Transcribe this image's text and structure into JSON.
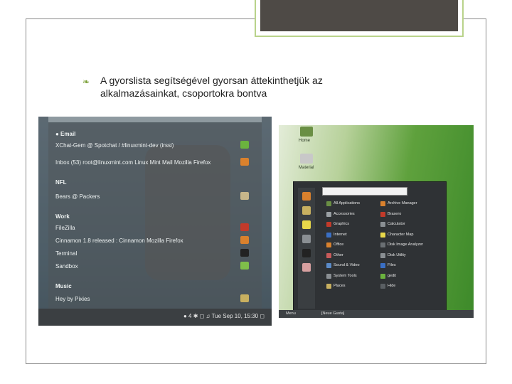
{
  "slide": {
    "bullet_text": "A gyorslista segítségével gyorsan áttekinthetjük az alkalmazásainkat, csoportokra bontva",
    "bullet_icon": "leaf-bullet-icon",
    "accent_color": "#7ea23c"
  },
  "left_screenshot": {
    "menu": [
      {
        "text": "● Email",
        "head": true
      },
      {
        "text": "XChat-Gem @ Spotchat / #linuxmint-dev (irssi)",
        "head": false,
        "icon_color": "#6bb33e"
      },
      {
        "text": "Inbox (53)   root@linuxmint.com   Linux Mint Mail   Mozilla Firefox",
        "head": false,
        "icon_color": "#d9812d"
      },
      {
        "text": "NFL",
        "head": true
      },
      {
        "text": "Bears @ Packers",
        "head": false,
        "icon_color": "#c7b68a"
      },
      {
        "text": "Work",
        "head": true
      },
      {
        "text": "FileZilla",
        "head": false,
        "icon_color": "#c23a2a"
      },
      {
        "text": "Cinnamon 1.8 released : Cinnamon   Mozilla Firefox",
        "head": false,
        "icon_color": "#d9812d"
      },
      {
        "text": "Terminal",
        "head": false,
        "icon_color": "#222222"
      },
      {
        "text": "Sandbox",
        "head": false,
        "icon_color": "#7fbf4a"
      },
      {
        "text": "Music",
        "head": true
      },
      {
        "text": "Hey by Pixies",
        "head": false,
        "icon_color": "#c8b060"
      }
    ],
    "tray_text": "● 4   ✱   ◻ ♫   Tue Sep 10, 15:30 ◻"
  },
  "right_screenshot": {
    "desktop_icons": [
      {
        "label": "Home",
        "color": "#6a8f44"
      },
      {
        "label": "Material",
        "color": "#c8c8c8"
      }
    ],
    "categories": [
      "All Applications",
      "Accessories",
      "Graphics",
      "Internet",
      "Office",
      "Other",
      "Sound & Video",
      "System Tools",
      "Places"
    ],
    "apps": [
      "Archive Manager",
      "Brasero",
      "Calculator",
      "Character Map",
      "Disk Image Analyzer",
      "Disk Utility",
      "Files",
      "gedit",
      "Hide"
    ],
    "taskbar": [
      "Menu",
      "[Neue Gusta]"
    ]
  }
}
